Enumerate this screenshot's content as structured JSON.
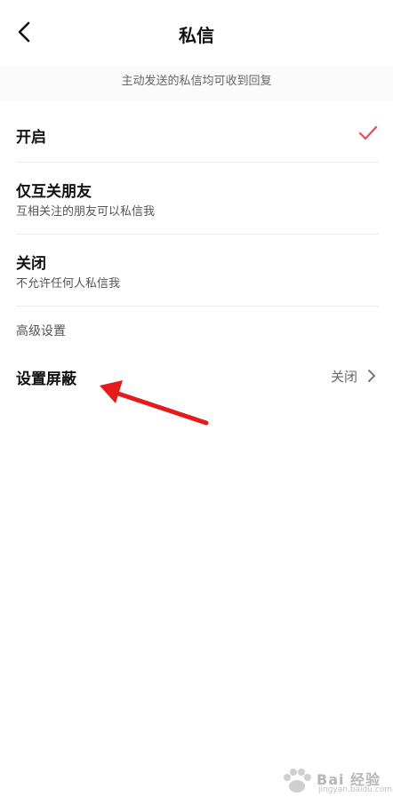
{
  "header": {
    "title": "私信",
    "hint": "主动发送的私信均可收到回复",
    "back_icon": "chevron-left-icon"
  },
  "options": [
    {
      "title": "开启",
      "subtitle": "",
      "selected": true
    },
    {
      "title": "仅互关朋友",
      "subtitle": "互相关注的朋友可以私信我",
      "selected": false
    },
    {
      "title": "关闭",
      "subtitle": "不允许任何人私信我",
      "selected": false
    }
  ],
  "section": {
    "title": "高级设置",
    "block_setting": {
      "label": "设置屏蔽",
      "value": "关闭"
    }
  },
  "colors": {
    "check": "#e94c5a",
    "arrow": "#e31b1b"
  },
  "watermark": {
    "brand": "Bai 经验",
    "url": "jingyan.baidu.com"
  }
}
